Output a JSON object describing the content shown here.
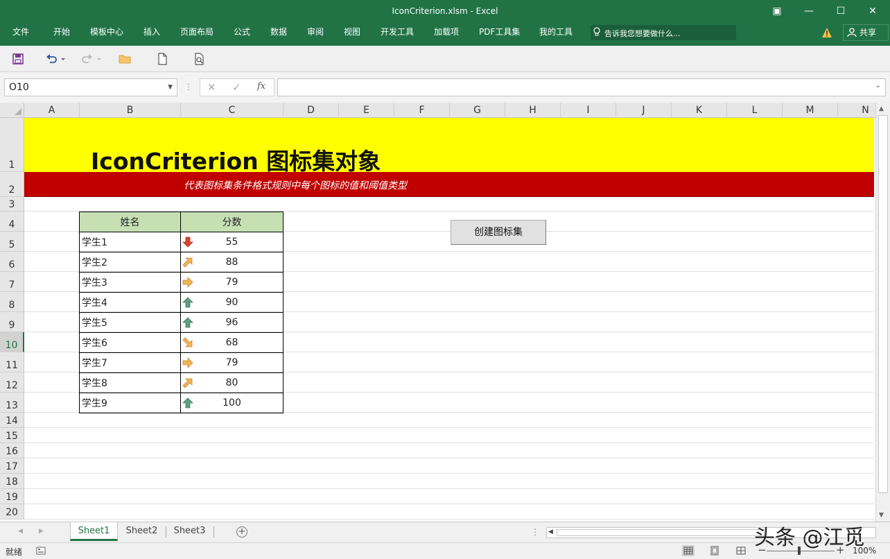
{
  "window": {
    "title": "IconCriterion.xlsm - Excel",
    "controls": [
      "▣",
      "—",
      "☐",
      "✕"
    ]
  },
  "menu": {
    "items": [
      "文件",
      "开始",
      "模板中心",
      "插入",
      "页面布局",
      "公式",
      "数据",
      "审阅",
      "视图",
      "开发工具",
      "加载项",
      "PDF工具集",
      "我的工具"
    ],
    "tell_me": "告诉我您想要做什么...",
    "share": "共享"
  },
  "formula_bar": {
    "name_box": "O10",
    "fx_label": "fx",
    "content": ""
  },
  "sheet": {
    "columns": [
      "A",
      "B",
      "C",
      "D",
      "E",
      "F",
      "G",
      "H",
      "I",
      "J",
      "K",
      "L",
      "M",
      "N"
    ],
    "rows": [
      "1",
      "2",
      "3",
      "4",
      "5",
      "6",
      "7",
      "8",
      "9",
      "10",
      "11",
      "12",
      "13",
      "14",
      "15",
      "16",
      "17",
      "18",
      "19",
      "20"
    ],
    "active_row": "10",
    "title": "IconCriterion 图标集对象",
    "subtitle": "代表图标集条件格式规则中每个图标的值和阈值类型",
    "table": {
      "headers": [
        "姓名",
        "分数"
      ],
      "rows": [
        {
          "name": "学生1",
          "score": "55",
          "icon": "arrow-down-icon",
          "color": "#d9442b"
        },
        {
          "name": "学生2",
          "score": "88",
          "icon": "arrow-up-right-icon",
          "color": "#f0b35a"
        },
        {
          "name": "学生3",
          "score": "79",
          "icon": "arrow-right-icon",
          "color": "#f0b35a"
        },
        {
          "name": "学生4",
          "score": "90",
          "icon": "arrow-up-icon",
          "color": "#5f9e84"
        },
        {
          "name": "学生5",
          "score": "96",
          "icon": "arrow-up-icon",
          "color": "#5f9e84"
        },
        {
          "name": "学生6",
          "score": "68",
          "icon": "arrow-down-right-icon",
          "color": "#f0b35a"
        },
        {
          "name": "学生7",
          "score": "79",
          "icon": "arrow-right-icon",
          "color": "#f0b35a"
        },
        {
          "name": "学生8",
          "score": "80",
          "icon": "arrow-up-right-icon",
          "color": "#f0b35a"
        },
        {
          "name": "学生9",
          "score": "100",
          "icon": "arrow-up-icon",
          "color": "#5f9e84"
        }
      ]
    },
    "button_label": "创建图标集"
  },
  "tabs": {
    "sheets": [
      "Sheet1",
      "Sheet2",
      "Sheet3"
    ],
    "active": "Sheet1",
    "add_label": "+"
  },
  "status": {
    "ready": "就绪",
    "zoom": "100%"
  },
  "watermark": "头条 @江觅",
  "colors": {
    "excel_green": "#217346",
    "title_fill": "#ffff00",
    "subtitle_fill": "#c00000",
    "header_fill": "#c6e0b4"
  }
}
